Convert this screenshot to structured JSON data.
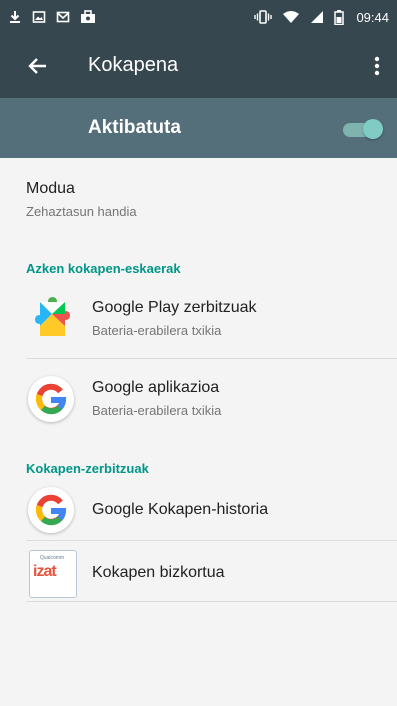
{
  "status_bar": {
    "time": "09:44",
    "left_icons": [
      "download-icon",
      "image-icon",
      "mail-icon",
      "briefcase-icon"
    ],
    "right_icons": [
      "vibrate-icon",
      "wifi-icon",
      "signal-icon",
      "battery-icon"
    ]
  },
  "toolbar": {
    "title": "Kokapena",
    "back_icon": "arrow-left-icon",
    "menu_icon": "more-vertical-icon"
  },
  "master_toggle": {
    "label": "Aktibatuta",
    "state": "on",
    "accent": "#80cbc4"
  },
  "mode": {
    "label": "Modua",
    "value": "Zehaztasun handia"
  },
  "recent_requests": {
    "header": "Azken kokapen-eskaerak",
    "items": [
      {
        "name": "Google Play zerbitzuak",
        "detail": "Bateria-erabilera txikia",
        "icon": "google-play-services-icon"
      },
      {
        "name": "Google aplikazioa",
        "detail": "Bateria-erabilera txikia",
        "icon": "google-g-icon"
      }
    ]
  },
  "location_services": {
    "header": "Kokapen-zerbitzuak",
    "items": [
      {
        "name": "Google Kokapen-historia",
        "icon": "google-g-icon"
      },
      {
        "name": "Kokapen bizkortua",
        "icon": "izat-icon",
        "icon_caption": "Qualcomm",
        "icon_wordmark": "izat"
      }
    ]
  },
  "colors": {
    "toolbar": "#37474f",
    "toggle_bar": "#546e7a",
    "section_header": "#009688",
    "background": "#f4f4f4"
  }
}
